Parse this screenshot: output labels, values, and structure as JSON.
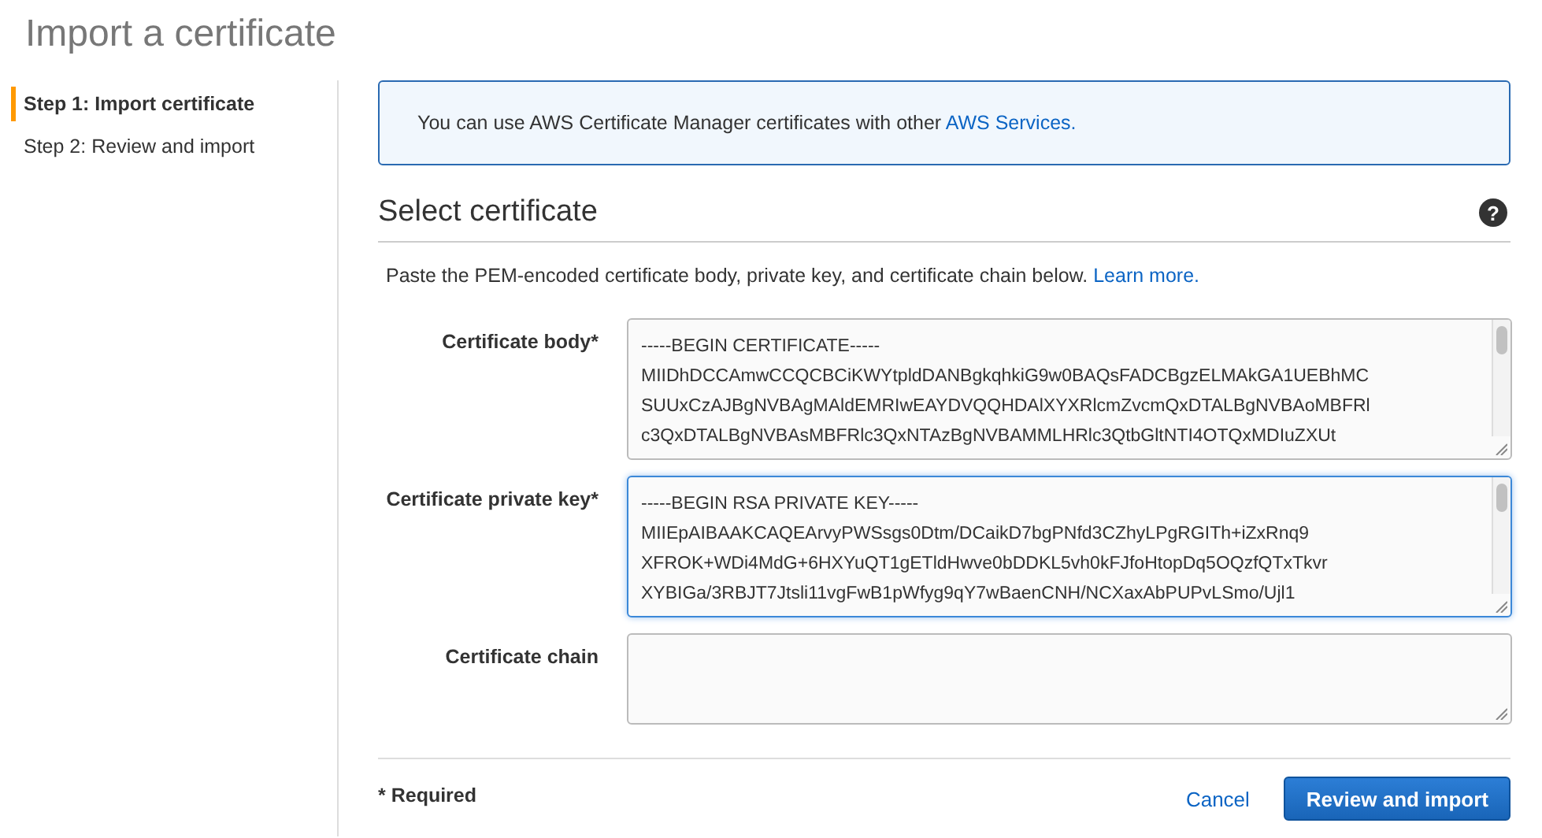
{
  "page_title": "Import a certificate",
  "steps": [
    {
      "label": "Step 1: Import certificate",
      "selected": true
    },
    {
      "label": "Step 2: Review and import",
      "selected": false
    }
  ],
  "info": {
    "text": "You can use AWS Certificate Manager certificates with other ",
    "link": "AWS Services."
  },
  "section": {
    "title": "Select certificate",
    "help": "?",
    "description": "Paste the PEM-encoded certificate body, private key, and certificate chain below. ",
    "link": "Learn more."
  },
  "fields": [
    {
      "label": "Certificate body*",
      "focused": false,
      "lines": [
        "-----BEGIN CERTIFICATE-----",
        "MIIDhDCCAmwCCQCBCiKWYtpldDANBgkqhkiG9w0BAQsFADCBgzELMAkGA1UEBhMC",
        "SUUxCzAJBgNVBAgMAldEMRIwEAYDVQQHDAlXYXRlcmZvcmQxDTALBgNVBAoMBFRl",
        "c3QxDTALBgNVBAsMBFRlc3QxNTAzBgNVBAMMLHRlc3QtbGltNTI4OTQxMDIuZXUt"
      ]
    },
    {
      "label": "Certificate private key*",
      "focused": true,
      "lines": [
        "-----BEGIN RSA PRIVATE KEY-----",
        "MIIEpAIBAAKCAQEArvyPWSsgs0Dtm/DCaikD7bgPNfd3CZhyLPgRGITh+iZxRnq9",
        "XFROK+WDi4MdG+6HXYuQT1gETldHwve0bDDKL5vh0kFJfoHtopDq5OQzfQTxTkvr",
        "XYBIGa/3RBJT7Jtsli11vgFwB1pWfyg9qY7wBaenCNH/NCXaxAbPUPvLSmo/Ujl1"
      ]
    },
    {
      "label": "Certificate chain",
      "focused": false
    }
  ],
  "required_note": "* Required",
  "buttons": {
    "cancel": "Cancel",
    "submit": "Review and import"
  }
}
